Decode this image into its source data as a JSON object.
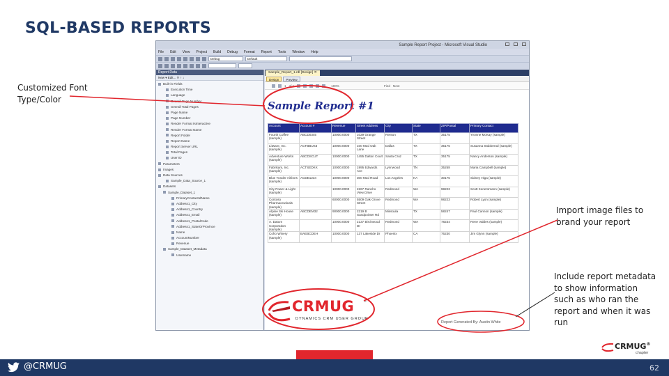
{
  "slide": {
    "title": "SQL-BASED REPORTS",
    "callouts": {
      "font": "Customized Font Type/Color",
      "image": "Import image files to brand your report",
      "metadata": "Include report metadata to show information such as who ran the report and when it was run"
    },
    "footer": {
      "handle": "@CRMUG",
      "page_number": "62"
    },
    "colors": {
      "title": "#1f3864",
      "footer": "#1f3864",
      "brand_red": "#e1262d",
      "report_header": "#1f2b8f"
    }
  },
  "vs": {
    "window_title": "Sample Report Project - Microsoft Visual Studio",
    "menu": [
      "File",
      "Edit",
      "View",
      "Project",
      "Build",
      "Debug",
      "Format",
      "Report",
      "Tools",
      "Window",
      "Help"
    ],
    "toolbar": {
      "config": "Debug",
      "default": "Default"
    },
    "left_panel": {
      "title": "Report Data",
      "toolbar": "New ▾ Edit... ✕ ↑ ↓",
      "items": [
        "Built-in Fields",
        "Execution Time",
        "Language",
        "Overall Page Number",
        "Overall Total Pages",
        "Page Name",
        "Page Number",
        "Render Format IsInteractive",
        "Render Format Name",
        "Report Folder",
        "Report Name",
        "Report Server URL",
        "Total Pages",
        "User ID",
        "Parameters",
        "Images",
        "Data Sources",
        "Sample_Data_Source_1",
        "Datasets",
        "Sample_Dataset_1",
        "PrimaryContactIdName",
        "Address1_City",
        "Address1_Country",
        "Address1_Email",
        "Address1_PostalCode",
        "Address1_StateOrProvince",
        "Name",
        "AccountNumber",
        "Revenue",
        "Sample_Dataset_Metadata",
        "Username"
      ]
    },
    "doc_tab": "Sample_Report_1.rdl [Design] ✕",
    "design_tabs": {
      "design": "Design",
      "preview": "Preview"
    },
    "report_toolbar": {
      "page": "1",
      "of": "of 1",
      "zoom": "100%",
      "find": "Find",
      "next": "Next"
    }
  },
  "report": {
    "title": "Sample Report #1",
    "columns": [
      "Account",
      "Account #",
      "Revenue",
      "Street Address",
      "City",
      "State",
      "ZIP/Postal",
      "Primary Contact"
    ],
    "rows": [
      [
        "Fourth Coffee (sample)",
        "ABCD0345",
        "10000.0000",
        "1029 Orange Street",
        "Renton",
        "TX",
        "35175",
        "Yvonne McKay (sample)"
      ],
      [
        "Litware, Inc. (sample)",
        "ACTBBUS3",
        "10000.0000",
        "100 Mod Oak Lane",
        "Dallas",
        "TX",
        "35175",
        "Susanna Stubberod (sample)"
      ],
      [
        "Adventure Works (sample)",
        "ABCDSCUT",
        "10000.0000",
        "1455 Dalton Court",
        "Santa Cruz",
        "TX",
        "35175",
        "Nancy Anderson (sample)"
      ],
      [
        "Fabrikam, Inc. (sample)",
        "ACTSEDKK",
        "10000.0000",
        "1995 Edwards Ave",
        "Lynnwood",
        "TN",
        "35258",
        "Maria Campbell (sample)"
      ],
      [
        "Blue Yonder Airlines (sample)",
        "ACDE1234",
        "10000.0000",
        "300 Mod Road",
        "Los Angeles",
        "KA",
        "30175",
        "Sidney Higa (sample)"
      ],
      [
        "City Power & Light (sample)",
        "",
        "10000.0000",
        "2267 Rancho View Drive",
        "Redmond",
        "WA",
        "98223",
        "Scott Konersmann (sample)"
      ],
      [
        "Contoso Pharmaceuticals (sample)",
        "",
        "60000.0000",
        "5509 Oak Grove Street",
        "Redmond",
        "WA",
        "98223",
        "Robert Lyon (sample)"
      ],
      [
        "Alpine Ski House (sample)",
        "ABCDEM32",
        "90000.0000",
        "2219 B Sandpointer Rd",
        "Missoula",
        "TX",
        "58247",
        "Paul Cannon (sample)"
      ],
      [
        "A. Datum Corporation (sample)",
        "",
        "10000.0000",
        "2137 Birchwood Dr",
        "Redmond",
        "WA",
        "78234",
        "Rene Valdes (sample)"
      ],
      [
        "Coho Winery (sample)",
        "BAEBCDEH",
        "10000.0000",
        "137 Lakeside Dr",
        "Phoenix",
        "CA",
        "76230",
        "Jim Glynn (sample)"
      ]
    ],
    "logo": {
      "word": "CRMUG",
      "registered": "®",
      "tagline": "DYNAMICS CRM USER GROUP"
    },
    "metadata_text": "Report Generated By: Austin White"
  },
  "chapter_logo": {
    "word": "CRMUG",
    "registered": "®",
    "sub": "chapter"
  }
}
